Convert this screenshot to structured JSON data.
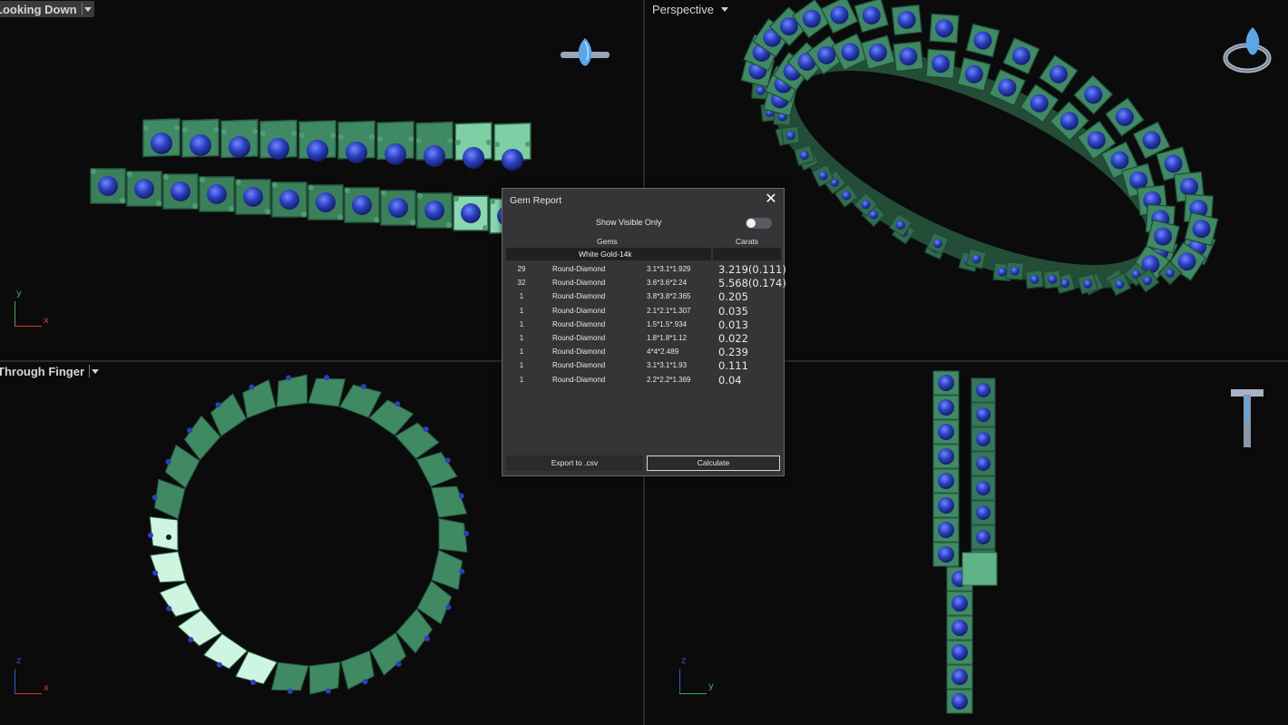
{
  "viewports": {
    "top_left": {
      "label": "Looking Down",
      "axis_y": "y",
      "axis_x": "x"
    },
    "top_right": {
      "label": "Perspective"
    },
    "bottom_left": {
      "label": "Through Finger",
      "axis_y": "z",
      "axis_x": "x"
    },
    "bottom_right": {
      "label": "",
      "axis_y": "z",
      "axis_x": "y"
    }
  },
  "colors": {
    "metal": "#3f8a63",
    "metal_light": "#a8e6c6",
    "gem": "#2a3fb8",
    "background": "#0b0b0c"
  },
  "gem_report": {
    "title": "Gem Report",
    "close_icon": "close-icon",
    "show_visible_label": "Show Visible Only",
    "show_visible_on": false,
    "col_gems": "Gems",
    "col_carats": "Carats",
    "metal": "White Gold-14k",
    "rows": [
      {
        "count": "29",
        "type": "Round-Diamond",
        "size": "3.1*3.1*1.929",
        "carats": "3.219(0.111)"
      },
      {
        "count": "32",
        "type": "Round-Diamond",
        "size": "3.6*3.6*2.24",
        "carats": "5.568(0.174)"
      },
      {
        "count": "1",
        "type": "Round-Diamond",
        "size": "3.8*3.8*2.365",
        "carats": "0.205"
      },
      {
        "count": "1",
        "type": "Round-Diamond",
        "size": "2.1*2.1*1.307",
        "carats": "0.035"
      },
      {
        "count": "1",
        "type": "Round-Diamond",
        "size": "1.5*1.5*.934",
        "carats": "0.013"
      },
      {
        "count": "1",
        "type": "Round-Diamond",
        "size": "1.8*1.8*1.12",
        "carats": "0.022"
      },
      {
        "count": "1",
        "type": "Round-Diamond",
        "size": "4*4*2.489",
        "carats": "0.239"
      },
      {
        "count": "1",
        "type": "Round-Diamond",
        "size": "3.1*3.1*1.93",
        "carats": "0.111"
      },
      {
        "count": "1",
        "type": "Round-Diamond",
        "size": "2.2*2.2*1.369",
        "carats": "0.04"
      }
    ],
    "export_label": "Export to .csv",
    "calculate_label": "Calculate"
  }
}
